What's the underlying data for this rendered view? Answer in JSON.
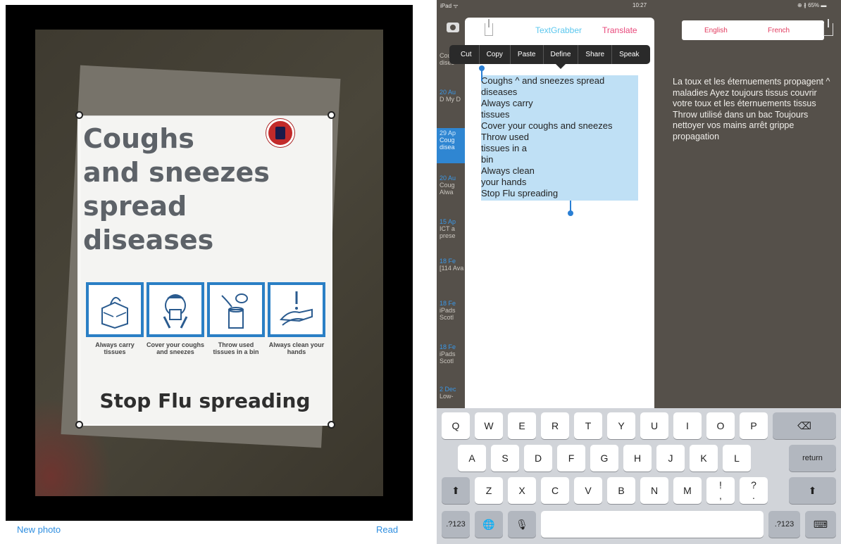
{
  "left": {
    "poster": {
      "headline": "Coughs\nand sneezes\nspread\ndiseases",
      "captions": [
        "Always carry tissues",
        "Cover your coughs and sneezes",
        "Throw used tissues in a bin",
        "Always clean your hands"
      ],
      "stop_text": "Stop Flu spreading"
    },
    "bottom": {
      "new_photo": "New photo",
      "read": "Read"
    }
  },
  "right": {
    "status": {
      "device": "iPad ᯤ",
      "time": "10:27",
      "battery": "⊕ ∦ 65% ▬"
    },
    "sidebar": [
      {
        "date": "",
        "text": "Cou dises"
      },
      {
        "date": "20 Au",
        "text": "D My D"
      },
      {
        "date": "29 Ap",
        "text": "Coug disea"
      },
      {
        "date": "20 Au",
        "text": "Coug Alwa"
      },
      {
        "date": "15 Ap",
        "text": "ICT a prese"
      },
      {
        "date": "18 Fe",
        "text": "[114 Ava"
      },
      {
        "date": "18 Fe",
        "text": "iPads Scotl"
      },
      {
        "date": "18 Fe",
        "text": "iPads Scotl"
      },
      {
        "date": "2 Dec",
        "text": "Low-"
      }
    ],
    "tabs": {
      "textgrabber": "TextGrabber",
      "translate": "Translate"
    },
    "edit_menu": [
      "Cut",
      "Copy",
      "Paste",
      "Define",
      "Share",
      "Speak"
    ],
    "ocr_text": "Coughs ^ and sneezes spread\ndiseases\nAlways carry\ntissues\nCover your coughs and sneezes\nThrow used\ntissues in a\nbin\nAlways clean\nyour hands\nStop Flu spreading",
    "languages": {
      "source": "English",
      "target": "French"
    },
    "translation": "La toux et les éternuements propagent ^ maladies Ayez toujours tissus couvrir votre toux et les éternuements tissus Throw utilisé dans un bac Toujours nettoyer vos mains arrêt grippe propagation",
    "keyboard": {
      "row1": [
        "Q",
        "W",
        "E",
        "R",
        "T",
        "Y",
        "U",
        "I",
        "O",
        "P",
        "⌫"
      ],
      "row2": [
        "A",
        "S",
        "D",
        "F",
        "G",
        "H",
        "J",
        "K",
        "L",
        "return"
      ],
      "row3": [
        "⬆",
        "Z",
        "X",
        "C",
        "V",
        "B",
        "N",
        "M",
        "!\n,",
        "?\n.",
        "⬆"
      ],
      "row4": [
        ".?123",
        "🌐",
        "🎙",
        "",
        ".?123",
        "⌨"
      ]
    }
  }
}
